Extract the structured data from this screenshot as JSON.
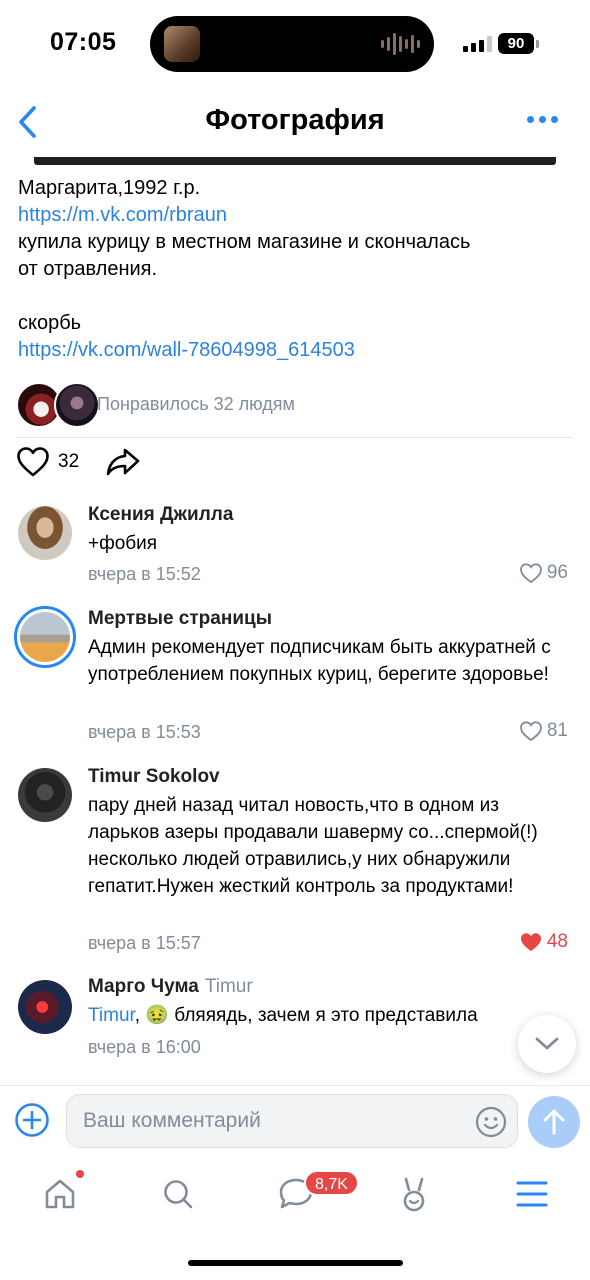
{
  "status": {
    "time": "07:05",
    "battery": "90"
  },
  "nav": {
    "title": "Фотография"
  },
  "post": {
    "line1": "Маргарита,1992 г.р.",
    "link1": "https://m.vk.com/rbraun",
    "line2": "купила курицу в местном магазине и скончалась",
    "line3": "от отравления.",
    "line4": "скорбь",
    "link2": "https://vk.com/wall-78604998_614503",
    "liked_by": "Понравилось 32 людям",
    "like_count": "32"
  },
  "comments": [
    {
      "author": "Ксения Джилла",
      "text": "+фобия",
      "date": "вчера в 15:52",
      "likes": "96"
    },
    {
      "author": "Мертвые страницы",
      "text": "Админ рекомендует подписчикам быть аккуратней с употреблением покупных куриц, берегите здоровье!",
      "date": "вчера в 15:53",
      "likes": "81"
    },
    {
      "author": "Timur Sokolov",
      "text": "пару дней назад читал новость,что в одном из ларьков азеры продавали шаверму со...спермой(!) несколько людей отравились,у них обнаружили гепатит.Нужен жесткий контроль за продуктами!",
      "date": "вчера в 15:57",
      "likes": "48"
    },
    {
      "author": "Марго Чума",
      "reply_to": "Timur",
      "mention": "Timur",
      "text": ", 🤢 бляяядь, зачем я это представила",
      "date": "вчера в 16:00"
    }
  ],
  "composer": {
    "placeholder": "Ваш комментарий"
  },
  "tabbar": {
    "messages_badge": "8,7K"
  },
  "colors": {
    "accent": "#2787f5",
    "link": "#2a82e4",
    "secondary": "#818c99",
    "liked": "#e64646"
  },
  "icons": [
    "back-icon",
    "more-icon",
    "heart-icon",
    "share-icon",
    "plus-icon",
    "emoji-icon",
    "send-arrow-icon",
    "home-icon",
    "search-icon",
    "messages-icon",
    "clips-icon",
    "menu-icon",
    "chevron-down-icon"
  ]
}
